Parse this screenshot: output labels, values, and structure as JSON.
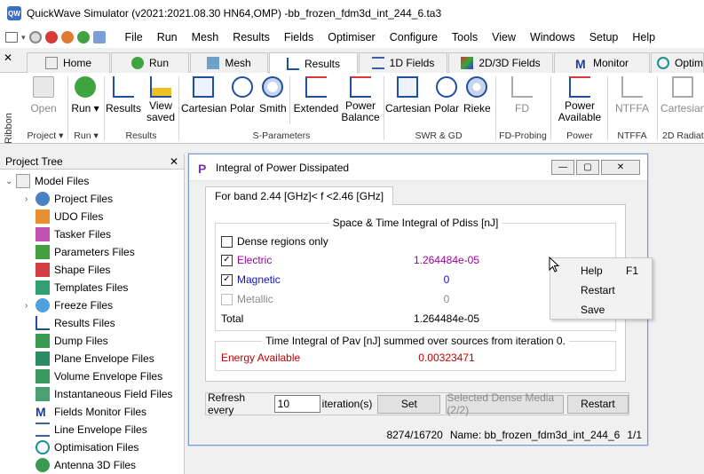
{
  "window": {
    "title": "QuickWave Simulator (v2021:2021.08.30 HN64,OMP) -bb_frozen_fdm3d_int_244_6.ta3"
  },
  "menu": [
    "File",
    "Run",
    "Mesh",
    "Results",
    "Fields",
    "Optimiser",
    "Configure",
    "Tools",
    "View",
    "Windows",
    "Setup",
    "Help"
  ],
  "ribbon": {
    "side_label": "Ribbon",
    "tabs": [
      "Home",
      "Run",
      "Mesh",
      "Results",
      "1D Fields",
      "2D/3D Fields",
      "Monitor",
      "Optim"
    ],
    "active_tab": "Results",
    "buttons": {
      "open": "Open",
      "run": "Run",
      "results": "Results",
      "view_saved_1": "View",
      "view_saved_2": "saved",
      "cartesian": "Cartesian",
      "polar": "Polar",
      "smith": "Smith",
      "extended": "Extended",
      "power_balance_1": "Power",
      "power_balance_2": "Balance",
      "swr_cartesian": "Cartesian",
      "swr_polar": "Polar",
      "rieke": "Rieke",
      "fd": "FD",
      "power_available_1": "Power",
      "power_available_2": "Available",
      "ntffa": "NTFFA",
      "rad_cartesian": "Cartesian"
    },
    "groups": {
      "project": "Project",
      "run": "Run",
      "results": "Results",
      "sparams": "S-Parameters",
      "swr": "SWR & GD",
      "fd_probing": "FD-Probing",
      "power": "Power",
      "ntffa": "NTFFA",
      "radiation": "2D Radiatio"
    }
  },
  "tree": {
    "title": "Project Tree",
    "close": "✕",
    "root": "Model Files",
    "items": [
      "Project Files",
      "UDO Files",
      "Tasker Files",
      "Parameters Files",
      "Shape Files",
      "Templates Files",
      "Freeze Files",
      "Results Files",
      "Dump Files",
      "Plane Envelope Files",
      "Volume Envelope Files",
      "Instantaneous Field Files",
      "Fields Monitor Files",
      "Line Envelope Files",
      "Optimisation Files",
      "Antenna 3D Files"
    ]
  },
  "dialog": {
    "title": "Integral of Power Dissipated",
    "band_tab": "For band 2.44 [GHz]< f <2.46 [GHz]",
    "space_group": "Space & Time Integral of Pdiss [nJ]",
    "dense_only": "Dense regions only",
    "electric_label": "Electric",
    "electric_value": "1.264484e-05",
    "magnetic_label": "Magnetic",
    "magnetic_value": "0",
    "metallic_label": "Metallic",
    "metallic_value": "0",
    "total_label": "Total",
    "total_value": "1.264484e-05",
    "time_group": "Time Integral of Pav [nJ] summed over sources from iteration 0.",
    "energy_label": "Energy Available",
    "energy_value": "0.00323471",
    "refresh_label": "Refresh every",
    "refresh_value": "10",
    "iteration_label": "iteration(s)",
    "set_button": "Set",
    "dense_media_button": "Selected Dense Media (2/2)",
    "restart_button": "Restart",
    "status_count": "8274/16720",
    "status_name": "Name:  bb_frozen_fdm3d_int_244_6",
    "status_page": "1/1",
    "colors": {
      "electric": "#a000a0",
      "magnetic": "#1010c0",
      "energy": "#c00000"
    }
  },
  "context_menu": {
    "items": [
      {
        "label": "Help",
        "shortcut": "F1"
      },
      {
        "label": "Restart",
        "shortcut": ""
      },
      {
        "label": "Save",
        "shortcut": ""
      }
    ]
  }
}
